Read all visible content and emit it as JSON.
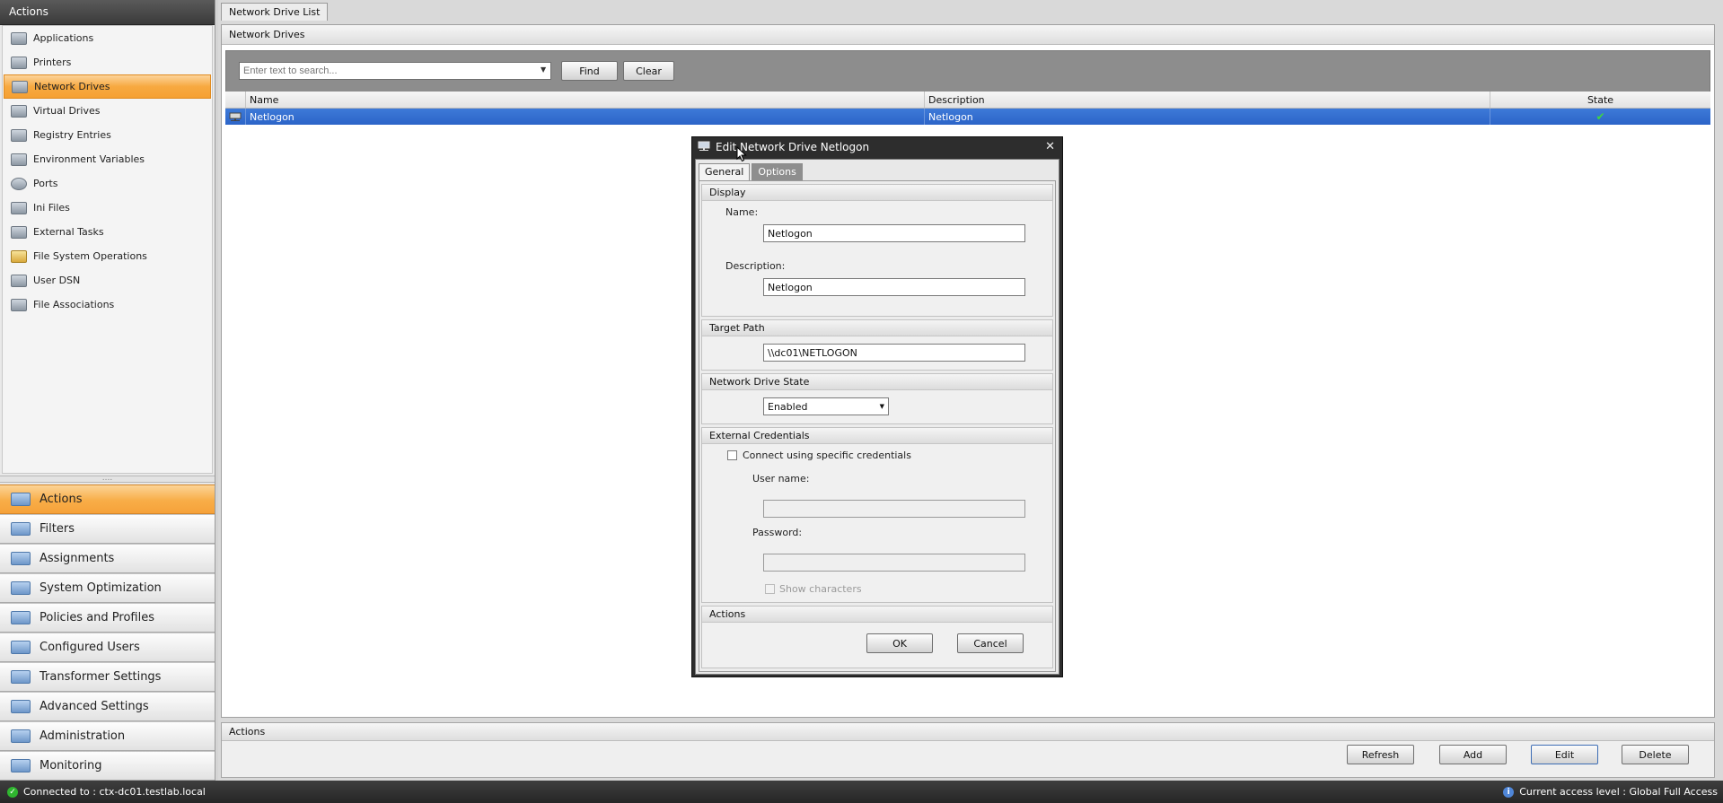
{
  "sidebar": {
    "header": "Actions",
    "items": [
      {
        "label": "Applications",
        "icon": "applications-icon"
      },
      {
        "label": "Printers",
        "icon": "printer-icon"
      },
      {
        "label": "Network Drives",
        "icon": "network-drive-icon",
        "selected": true
      },
      {
        "label": "Virtual Drives",
        "icon": "virtual-drive-icon"
      },
      {
        "label": "Registry Entries",
        "icon": "registry-icon"
      },
      {
        "label": "Environment Variables",
        "icon": "environment-variables-icon"
      },
      {
        "label": "Ports",
        "icon": "ports-icon"
      },
      {
        "label": "Ini Files",
        "icon": "ini-file-icon"
      },
      {
        "label": "External Tasks",
        "icon": "external-tasks-icon"
      },
      {
        "label": "File System Operations",
        "icon": "file-system-icon"
      },
      {
        "label": "User DSN",
        "icon": "user-dsn-icon"
      },
      {
        "label": "File Associations",
        "icon": "file-associations-icon"
      }
    ],
    "splitter": "....",
    "groups": [
      {
        "label": "Actions",
        "selected": true
      },
      {
        "label": "Filters"
      },
      {
        "label": "Assignments"
      },
      {
        "label": "System Optimization"
      },
      {
        "label": "Policies and Profiles"
      },
      {
        "label": "Configured Users"
      },
      {
        "label": "Transformer Settings"
      },
      {
        "label": "Advanced Settings"
      },
      {
        "label": "Administration"
      },
      {
        "label": "Monitoring"
      }
    ]
  },
  "main": {
    "doc_tab": "Network Drive List",
    "panel_title": "Network Drives",
    "search": {
      "placeholder": "Enter text to search...",
      "find": "Find",
      "clear": "Clear"
    },
    "grid": {
      "columns": [
        "Name",
        "Description",
        "State"
      ],
      "rows": [
        {
          "name": "Netlogon",
          "description": "Netlogon",
          "state": "enabled"
        }
      ]
    },
    "bottom": {
      "title": "Actions",
      "refresh": "Refresh",
      "add": "Add",
      "edit": "Edit",
      "delete": "Delete"
    }
  },
  "dialog": {
    "title": "Edit Network Drive Netlogon",
    "tabs": [
      "General",
      "Options"
    ],
    "display": {
      "title": "Display",
      "name_label": "Name:",
      "name_value": "Netlogon",
      "desc_label": "Description:",
      "desc_value": "Netlogon"
    },
    "target": {
      "title": "Target Path",
      "value": "\\\\dc01\\NETLOGON"
    },
    "state": {
      "title": "Network Drive State",
      "value": "Enabled"
    },
    "credentials": {
      "title": "External Credentials",
      "checkbox": "Connect using specific credentials",
      "user_label": "User name:",
      "pass_label": "Password:",
      "show_chars": "Show characters"
    },
    "actions": {
      "title": "Actions",
      "ok": "OK",
      "cancel": "Cancel"
    }
  },
  "status": {
    "left": "Connected to : ctx-dc01.testlab.local",
    "right": "Current access level  : Global Full Access"
  }
}
